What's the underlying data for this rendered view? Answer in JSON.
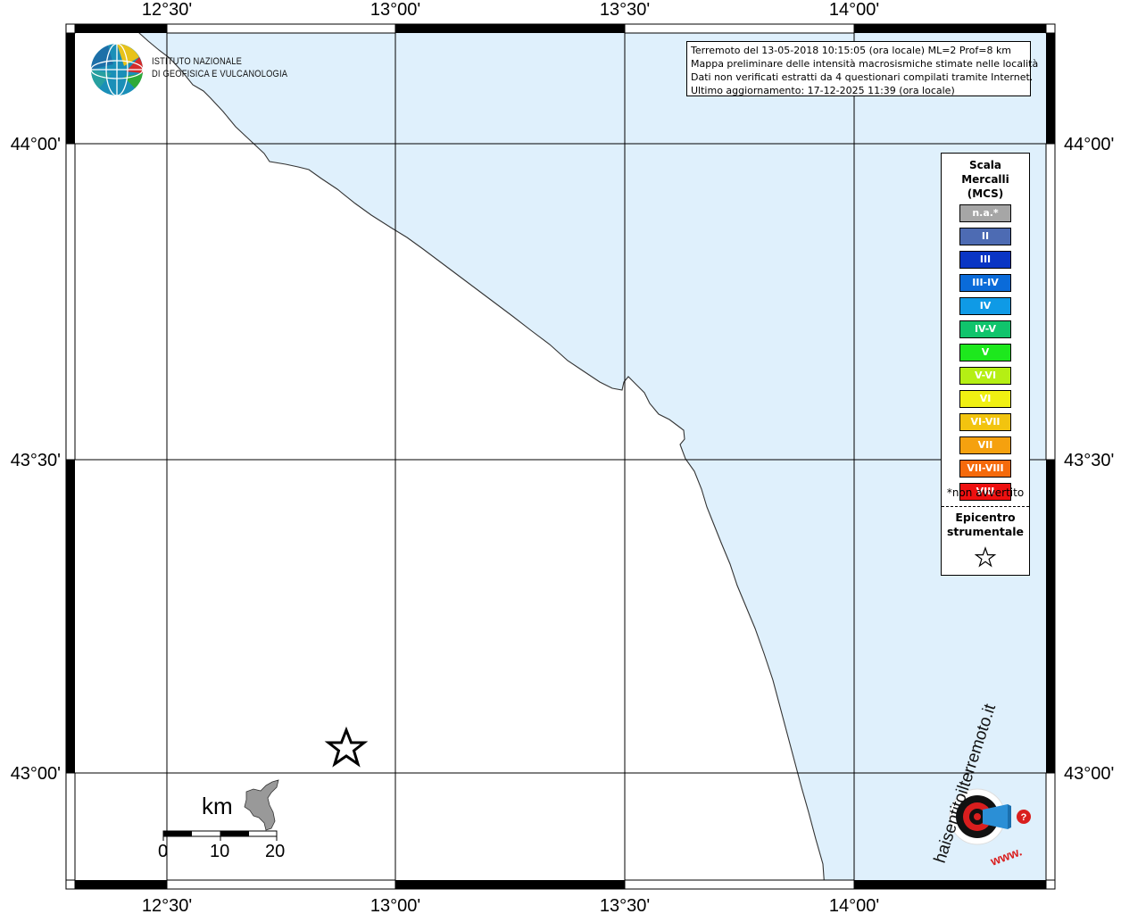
{
  "map": {
    "lon_labels": [
      "12°30'",
      "13°00'",
      "13°30'",
      "14°00'"
    ],
    "lat_labels": [
      "44°00'",
      "43°30'",
      "43°00'"
    ],
    "sea_color": "#dff0fc",
    "land_color": "#ffffff",
    "epicenter_symbol": "star"
  },
  "info": {
    "line1": "Terremoto del 13-05-2018 10:15:05 (ora locale) ML=2 Prof=8 km",
    "line2": "Mappa preliminare delle intensità macrosismiche stimate nelle località",
    "line3": "Dati non verificati estratti da 4 questionari compilati tramite Internet.",
    "line4": "Ultimo aggiornamento: 17-12-2025 11:39 (ora locale)"
  },
  "logo": {
    "line1": "ISTITUTO NAZIONALE",
    "line2": "DI GEOFISICA E VULCANOLOGIA",
    "icon": "ingv-globe-icon"
  },
  "legend": {
    "title1": "Scala",
    "title2": "Mercalli",
    "title3": "(MCS)",
    "items": [
      {
        "label": "n.a.*",
        "color": "#a6a6a6"
      },
      {
        "label": "II",
        "color": "#4d6bb3"
      },
      {
        "label": "III",
        "color": "#0a35c4"
      },
      {
        "label": "III-IV",
        "color": "#0a6bd9"
      },
      {
        "label": "IV",
        "color": "#0f9ae6"
      },
      {
        "label": "IV-V",
        "color": "#10c46c"
      },
      {
        "label": "V",
        "color": "#1de81d"
      },
      {
        "label": "V-VI",
        "color": "#b5ef14"
      },
      {
        "label": "VI",
        "color": "#f0f012"
      },
      {
        "label": "VI-VII",
        "color": "#f2c40f"
      },
      {
        "label": "VII",
        "color": "#f5a10f"
      },
      {
        "label": "VII-VIII",
        "color": "#f56a0c"
      },
      {
        "label": "VIII",
        "color": "#ee1010"
      }
    ],
    "note": "*non avvertito",
    "epicenter1": "Epicentro",
    "epicenter2": "strumentale"
  },
  "scale_bar": {
    "unit": "km",
    "ticks": [
      "0",
      "10",
      "20"
    ]
  },
  "brand": {
    "text": "haisentitoilterremoto.it",
    "url": "www."
  }
}
